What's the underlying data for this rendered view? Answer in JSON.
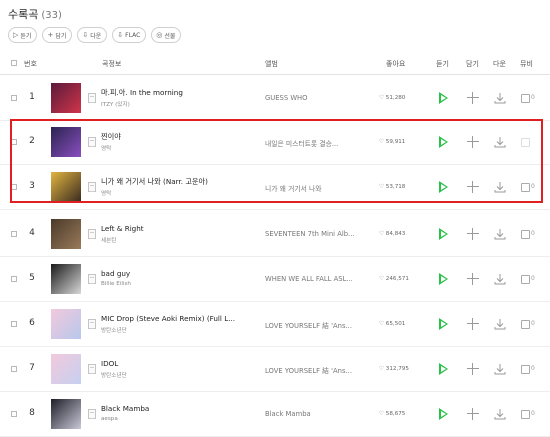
{
  "header": {
    "title": "수록곡",
    "count": "(33)"
  },
  "actions": [
    {
      "icon": "▷",
      "label": "듣기"
    },
    {
      "icon": "+",
      "label": "담기"
    },
    {
      "icon": "⇩",
      "label": "다운"
    },
    {
      "icon": "⇩",
      "label": "FLAC"
    },
    {
      "icon": "◎",
      "label": "선물"
    }
  ],
  "columns": {
    "number": "번호",
    "song": "곡정보",
    "album": "앨범",
    "likes": "좋아요",
    "listen": "듣기",
    "add": "담기",
    "download": "다운",
    "mv": "뮤비"
  },
  "rows": [
    {
      "number": "1",
      "title": "마.피.아. In the morning",
      "artist": "ITZY (있지)",
      "album": "GUESS WHO",
      "likes": "♡ 51,280",
      "art": [
        "#5a1a3a",
        "#d0354a"
      ],
      "mv_zero": "0"
    },
    {
      "number": "2",
      "title": "찐이야",
      "artist": "영탁",
      "album": "내일은 미스터트롯 결승...",
      "likes": "♡ 59,911",
      "art": [
        "#2b2350",
        "#8a4fc0"
      ],
      "mv_zero": ""
    },
    {
      "number": "3",
      "title": "니가 왜 거기서 나와 (Narr. 고운아)",
      "artist": "영탁",
      "album": "니가 왜 거기서 나와",
      "likes": "♡ 53,718",
      "art": [
        "#e2b640",
        "#3a2a20"
      ],
      "mv_zero": "0"
    },
    {
      "number": "4",
      "title": "Left & Right",
      "artist": "세븐틴",
      "album": "SEVENTEEN 7th Mini Alb...",
      "likes": "♡ 84,843",
      "art": [
        "#4a3a2a",
        "#9a7a5a"
      ],
      "mv_zero": "0"
    },
    {
      "number": "5",
      "title": "bad guy",
      "artist": "Billie Eilish",
      "album": "WHEN WE ALL FALL ASL...",
      "likes": "♡ 246,571",
      "art": [
        "#1a1a1a",
        "#d8d8d8"
      ],
      "mv_zero": "0"
    },
    {
      "number": "6",
      "title": "MIC Drop (Steve Aoki Remix) (Full L...",
      "artist": "방탄소년단",
      "album": "LOVE YOURSELF 結 'Ans...",
      "likes": "♡ 65,501",
      "art": [
        "#f2c9dc",
        "#b8c8ec"
      ],
      "mv_zero": "0"
    },
    {
      "number": "7",
      "title": "IDOL",
      "artist": "방탄소년단",
      "album": "LOVE YOURSELF 結 'Ans...",
      "likes": "♡ 312,795",
      "art": [
        "#f2c9dc",
        "#c6d0f0"
      ],
      "mv_zero": "0"
    },
    {
      "number": "8",
      "title": "Black Mamba",
      "artist": "aespa",
      "album": "Black Mamba",
      "likes": "♡ 58,675",
      "art": [
        "#1e1e28",
        "#c8c8d8"
      ],
      "mv_zero": "0"
    }
  ],
  "colors": {
    "accent_green": "#2ac04a",
    "highlight_red": "#e02020"
  }
}
